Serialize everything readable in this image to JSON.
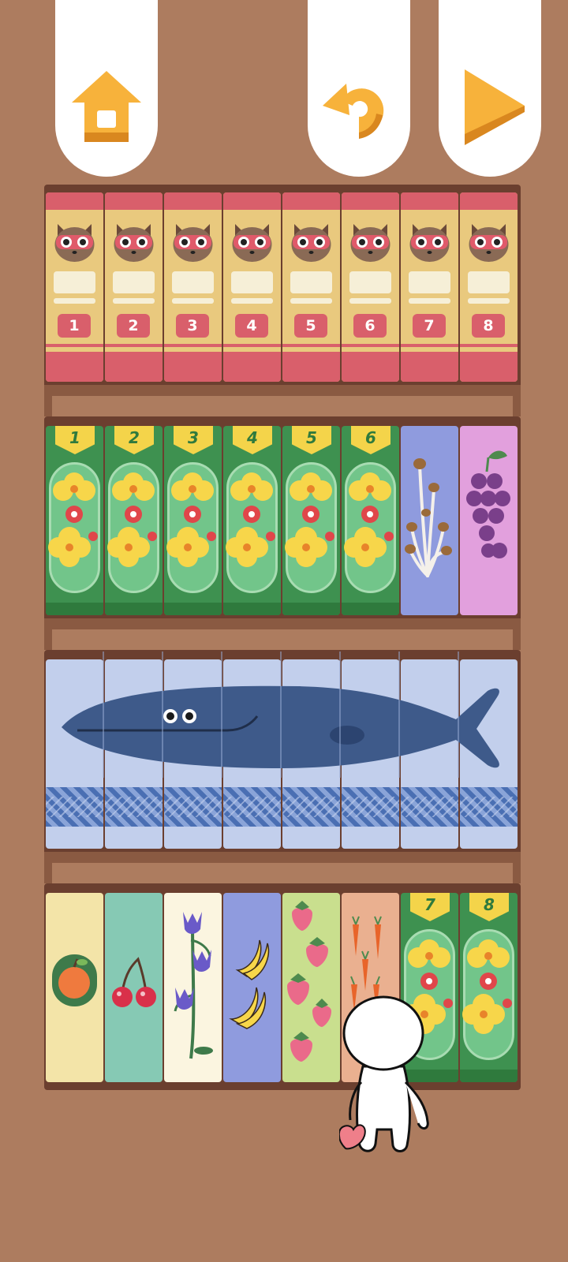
{
  "toolbar": {
    "home_icon": "home-icon",
    "undo_icon": "undo-icon",
    "play_icon": "play-icon",
    "icon_color": "#f7b23b"
  },
  "shelves": {
    "row1": {
      "theme": "raccoon",
      "numbers": [
        "1",
        "2",
        "3",
        "4",
        "5",
        "6",
        "7",
        "8"
      ]
    },
    "row2": {
      "theme": "flowers",
      "numbers": [
        "1",
        "2",
        "3",
        "4",
        "5",
        "6"
      ],
      "extra": [
        "mushroom",
        "grapes"
      ]
    },
    "row3": {
      "theme": "whale"
    },
    "row4": {
      "books": [
        "apple",
        "cherry",
        "tulip",
        "banana",
        "strawberry",
        "carrot"
      ],
      "flower_numbers": [
        "7",
        "8"
      ]
    }
  },
  "colors": {
    "background": "#ad7c5f",
    "shelf": "#6b3f2f",
    "raccoon_red": "#d95f6b",
    "flower_green": "#3e9150",
    "whale_blue": "#3e5a8a"
  }
}
